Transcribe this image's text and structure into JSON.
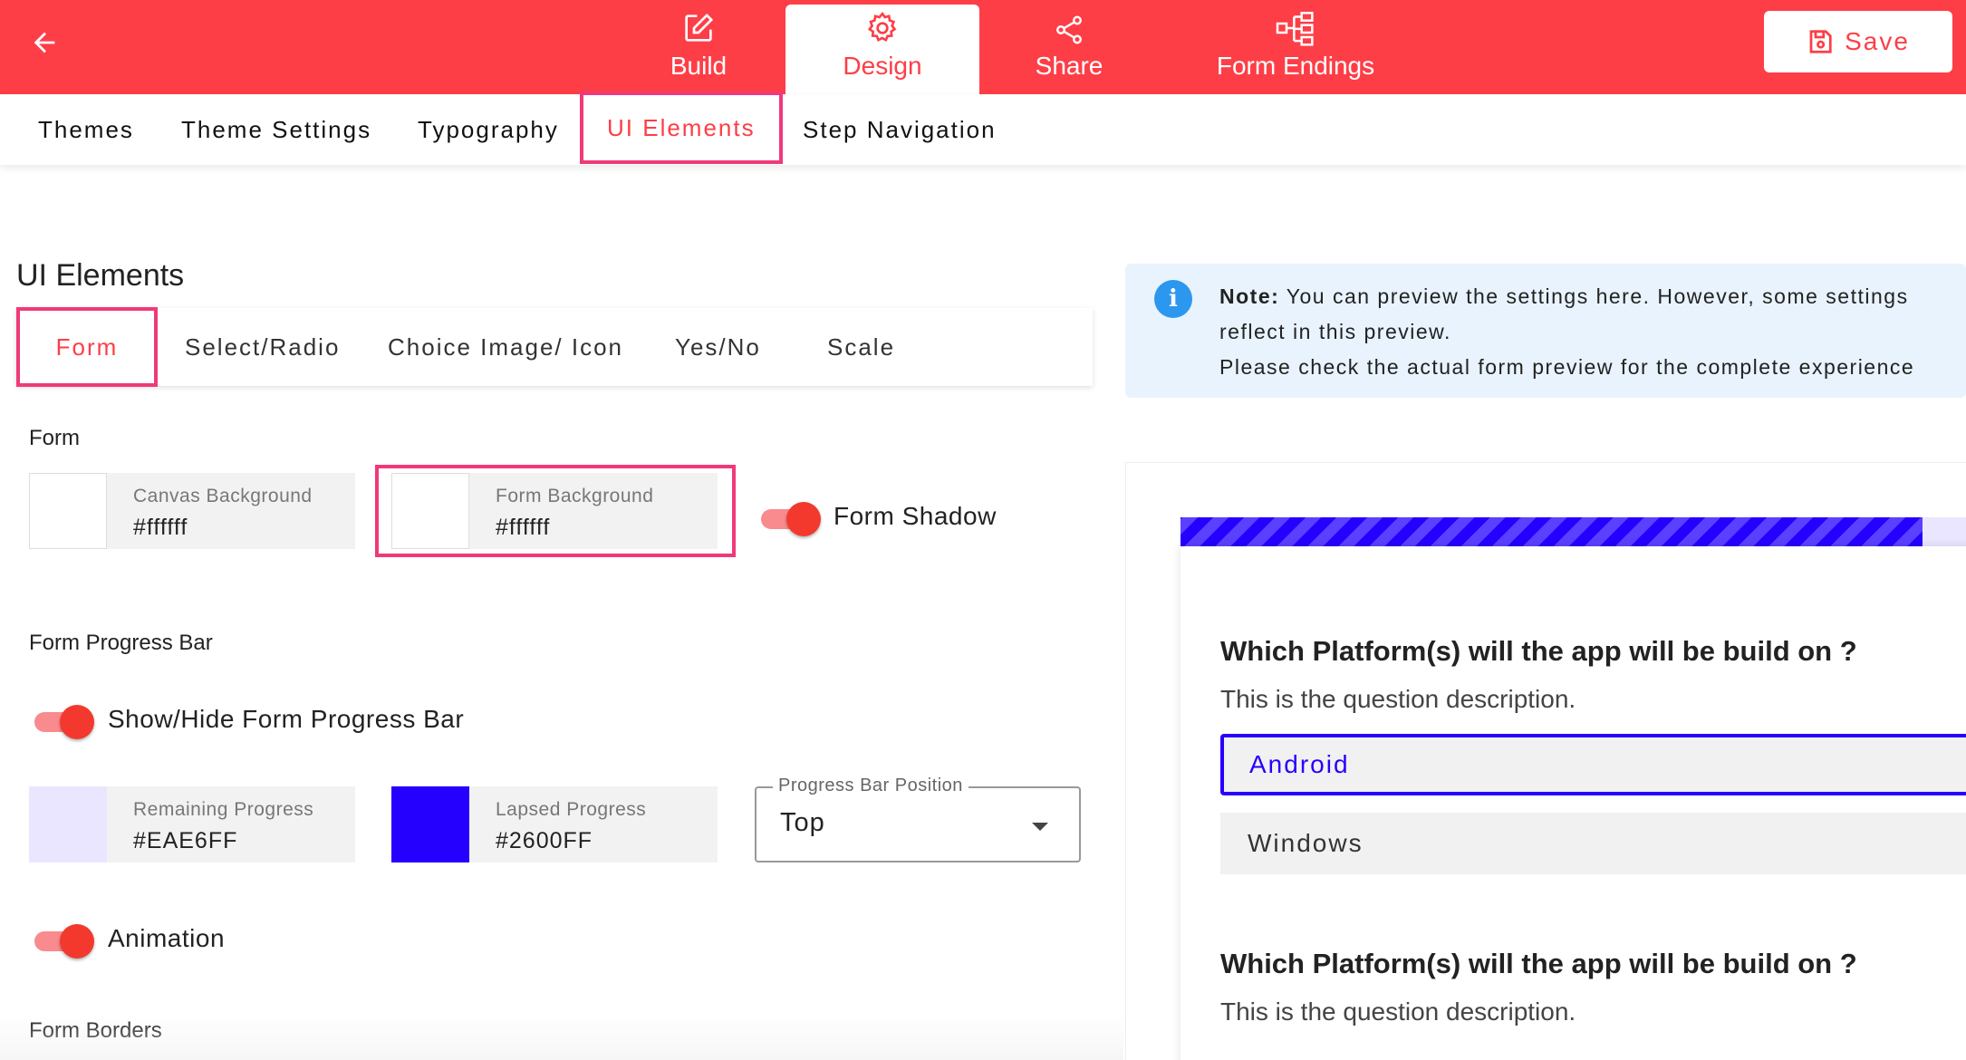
{
  "topbar": {
    "tabs": [
      {
        "label": "Build",
        "icon": "pencil-square-icon"
      },
      {
        "label": "Design",
        "icon": "gear-icon"
      },
      {
        "label": "Share",
        "icon": "share-icon"
      },
      {
        "label": "Form Endings",
        "icon": "flowchart-icon"
      }
    ],
    "active_tab": "Design",
    "save_label": "Save",
    "accent": "#fd3e47"
  },
  "subnav": {
    "items": [
      "Themes",
      "Theme Settings",
      "Typography",
      "UI Elements",
      "Step Navigation"
    ],
    "active": "UI Elements"
  },
  "ui_elements": {
    "title": "UI Elements",
    "tabs": [
      "Form",
      "Select/Radio",
      "Choice Image/ Icon",
      "Yes/No",
      "Scale"
    ],
    "active_tab": "Form"
  },
  "form_section": {
    "label": "Form",
    "canvas_background": {
      "label": "Canvas Background",
      "value": "#ffffff"
    },
    "form_background": {
      "label": "Form Background",
      "value": "#ffffff"
    },
    "form_shadow": {
      "label": "Form Shadow",
      "on": true
    }
  },
  "progress_section": {
    "label": "Form Progress Bar",
    "show_hide": {
      "label": "Show/Hide Form Progress Bar",
      "on": true
    },
    "remaining": {
      "label": "Remaining Progress",
      "value": "#EAE6FF"
    },
    "lapsed": {
      "label": "Lapsed Progress",
      "value": "#2600FF"
    },
    "position": {
      "legend": "Progress Bar Position",
      "value": "Top"
    },
    "animation": {
      "label": "Animation",
      "on": true
    }
  },
  "borders_section": {
    "label": "Form Borders"
  },
  "note": {
    "bold": "Note:",
    "line1": " You can preview the settings here. However, some settings",
    "line2": "reflect in this preview.",
    "line3": "Please check the actual form preview for the complete experience"
  },
  "preview": {
    "progress_fraction": 0.91,
    "questions": [
      {
        "title": "Which Platform(s) will the app will be build on ?",
        "description": "This is the question description.",
        "options": [
          {
            "label": "Android",
            "selected": true
          },
          {
            "label": "Windows",
            "selected": false
          }
        ]
      },
      {
        "title": "Which Platform(s) will the app will be build on ?",
        "description": "This is the question description."
      }
    ]
  }
}
